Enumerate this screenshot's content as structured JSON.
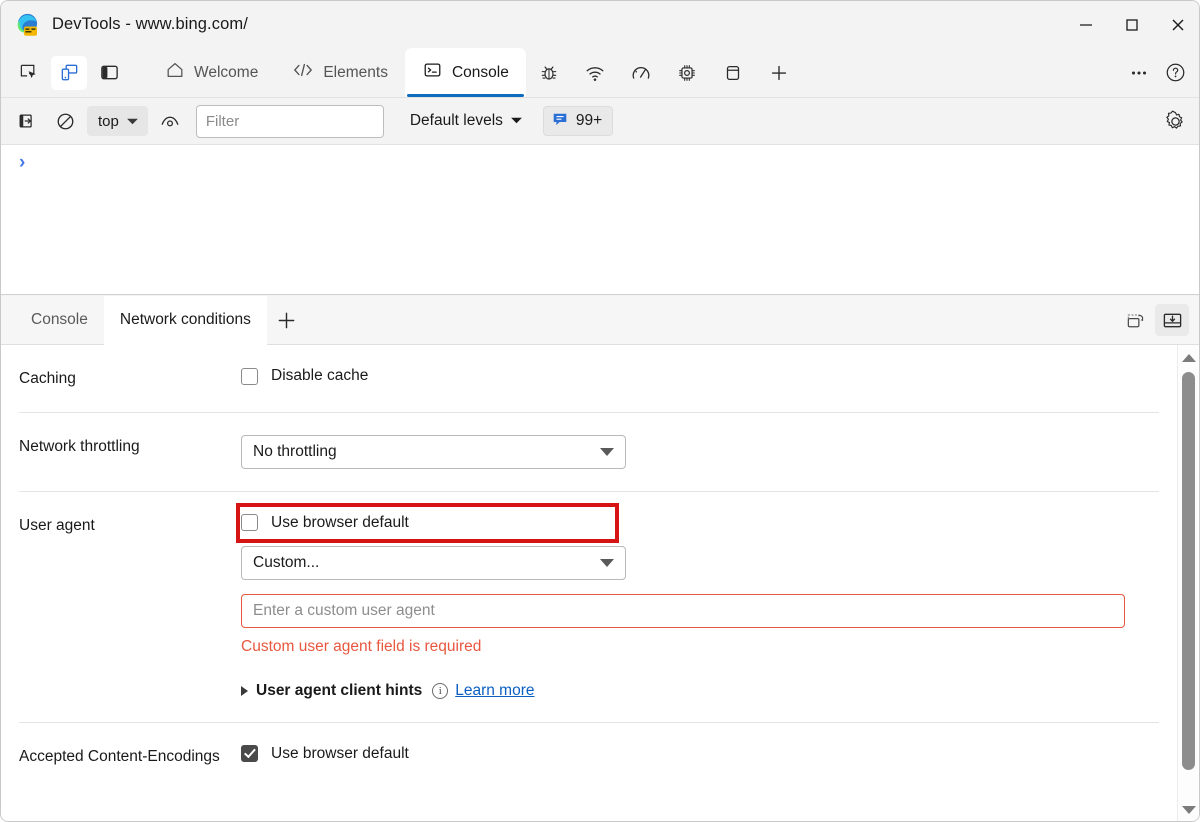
{
  "window": {
    "title": "DevTools - www.bing.com/",
    "logo_icon": "edge-devtools-logo",
    "controls": {
      "minimize": "minimize-icon",
      "maximize": "maximize-icon",
      "close": "close-icon"
    }
  },
  "toolbar": {
    "left_icons": [
      {
        "name": "inspect-element-icon",
        "label": "Inspect"
      },
      {
        "name": "device-emulation-icon",
        "label": "Toggle device emulation",
        "active": true
      },
      {
        "name": "dock-side-icon",
        "label": "Dock side"
      }
    ],
    "tabs": [
      {
        "label": "Welcome",
        "icon": "home-icon",
        "active": false
      },
      {
        "label": "Elements",
        "icon": "code-brackets-icon",
        "active": false
      },
      {
        "label": "Console",
        "icon": "console-terminal-icon",
        "active": true
      }
    ],
    "icon_tabs": [
      {
        "name": "sources-bug-icon"
      },
      {
        "name": "network-wifi-icon"
      },
      {
        "name": "performance-gauge-icon"
      },
      {
        "name": "memory-chip-icon"
      },
      {
        "name": "application-storage-icon"
      },
      {
        "name": "more-tabs-plus-icon"
      }
    ],
    "right_icons": [
      {
        "name": "more-options-icon"
      },
      {
        "name": "help-icon"
      }
    ]
  },
  "console_filterbar": {
    "clear_console_icon": "clear-console-icon",
    "no-entry_icon": "block-icon",
    "context_value": "top",
    "context_caret": "chevron-down-icon",
    "live_expression_icon": "eye-icon",
    "filter_placeholder": "Filter",
    "filter_value": "",
    "levels_label": "Default levels",
    "levels_caret": "chevron-down-icon",
    "issues_icon": "issues-speech-bubble-icon",
    "issues_count": "99+",
    "settings_icon": "gear-icon"
  },
  "console_output": {
    "prompt": "›"
  },
  "drawer": {
    "tabs": [
      {
        "label": "Console",
        "active": false
      },
      {
        "label": "Network conditions",
        "active": true
      }
    ],
    "add_tab_icon": "plus-icon",
    "right_icons": [
      {
        "name": "restore-drawer-icon"
      },
      {
        "name": "dock-to-bottom-icon",
        "pressed": true
      }
    ]
  },
  "network_conditions": {
    "caching": {
      "label": "Caching",
      "checkbox_label": "Disable cache",
      "checked": false
    },
    "throttling": {
      "label": "Network throttling",
      "selected": "No throttling"
    },
    "user_agent": {
      "label": "User agent",
      "checkbox_label": "Use browser default",
      "checked": false,
      "highlighted": true,
      "highlight_color": "#d61414",
      "selected": "Custom...",
      "input_placeholder": "Enter a custom user agent",
      "input_value": "",
      "error_message": "Custom user agent field is required",
      "error_color": "#e8573f",
      "client_hints_label": "User agent client hints",
      "info_icon": "info-icon",
      "learn_more_label": "Learn more",
      "link_color": "#0b5fc2"
    },
    "content_encodings": {
      "label": "Accepted Content-Encodings",
      "checkbox_label": "Use browser default",
      "checked": true
    }
  },
  "scrollbar": {
    "up_arrow_icon": "scroll-up-arrow-icon",
    "down_arrow_icon": "scroll-down-arrow-icon",
    "thumb": "scroll-thumb"
  }
}
